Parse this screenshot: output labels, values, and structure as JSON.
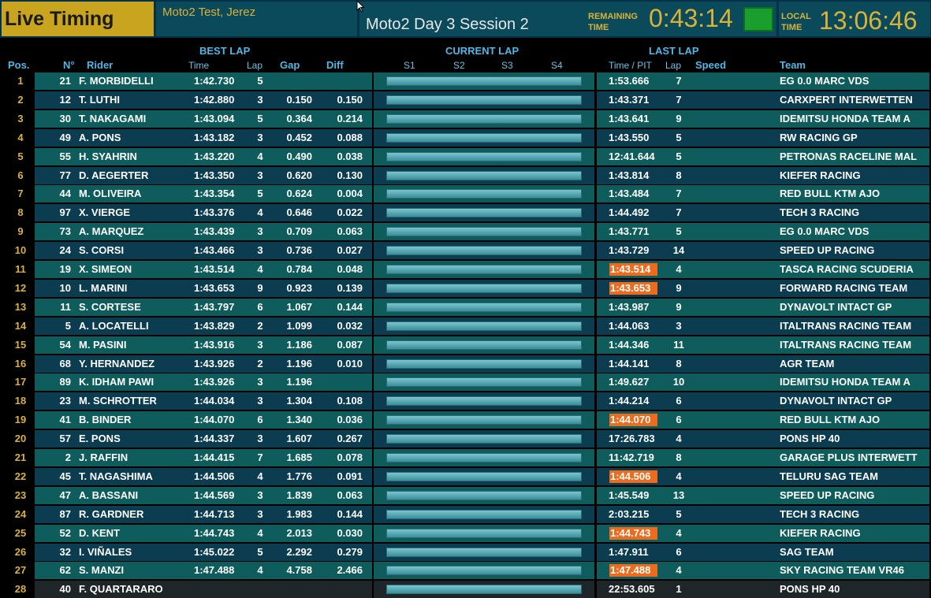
{
  "header": {
    "title": "Live Timing",
    "event": "Moto2 Test, Jerez",
    "session": "Moto2  Day 3 Session 2",
    "remaining_label_1": "REMAINING",
    "remaining_label_2": "TIME",
    "remaining_time": "0:43:14",
    "local_label_1": "LOCAL",
    "local_label_2": "TIME",
    "local_time": "13:06:46",
    "status_color": "#1a9f2e"
  },
  "columns": {
    "best_lap": "BEST LAP",
    "current_lap": "CURRENT LAP",
    "last_lap": "LAST LAP",
    "pos": "Pos.",
    "num": "N°",
    "rider": "Rider",
    "time": "Time",
    "lap": "Lap",
    "gap": "Gap",
    "diff": "Diff",
    "s1": "S1",
    "s2": "S2",
    "s3": "S3",
    "s4": "S4",
    "time_pit": "Time / PIT",
    "last_lap_col": "Lap",
    "speed": "Speed",
    "team": "Team"
  },
  "rows": [
    {
      "pos": "1",
      "num": "21",
      "rider": "F. MORBIDELLI",
      "time": "1:42.730",
      "lap": "5",
      "gap": "",
      "diff": "",
      "last": "1:53.666",
      "last_lap": "7",
      "team": "EG 0.0 MARC VDS",
      "hl": false
    },
    {
      "pos": "2",
      "num": "12",
      "rider": "T. LUTHI",
      "time": "1:42.880",
      "lap": "3",
      "gap": "0.150",
      "diff": "0.150",
      "last": "1:43.371",
      "last_lap": "7",
      "team": "CARXPERT INTERWETTEN",
      "hl": false
    },
    {
      "pos": "3",
      "num": "30",
      "rider": "T. NAKAGAMI",
      "time": "1:43.094",
      "lap": "5",
      "gap": "0.364",
      "diff": "0.214",
      "last": "1:43.641",
      "last_lap": "9",
      "team": "IDEMITSU HONDA TEAM A",
      "hl": false
    },
    {
      "pos": "4",
      "num": "49",
      "rider": "A. PONS",
      "time": "1:43.182",
      "lap": "3",
      "gap": "0.452",
      "diff": "0.088",
      "last": "1:43.550",
      "last_lap": "5",
      "team": "RW RACING GP",
      "hl": false
    },
    {
      "pos": "5",
      "num": "55",
      "rider": "H. SYAHRIN",
      "time": "1:43.220",
      "lap": "4",
      "gap": "0.490",
      "diff": "0.038",
      "last": "12:41.644",
      "last_lap": "5",
      "team": "PETRONAS RACELINE MAL",
      "hl": false
    },
    {
      "pos": "6",
      "num": "77",
      "rider": "D. AEGERTER",
      "time": "1:43.350",
      "lap": "3",
      "gap": "0.620",
      "diff": "0.130",
      "last": "1:43.814",
      "last_lap": "8",
      "team": "KIEFER RACING",
      "hl": false
    },
    {
      "pos": "7",
      "num": "44",
      "rider": "M. OLIVEIRA",
      "time": "1:43.354",
      "lap": "5",
      "gap": "0.624",
      "diff": "0.004",
      "last": "1:43.484",
      "last_lap": "7",
      "team": "RED BULL KTM AJO",
      "hl": false
    },
    {
      "pos": "8",
      "num": "97",
      "rider": "X. VIERGE",
      "time": "1:43.376",
      "lap": "4",
      "gap": "0.646",
      "diff": "0.022",
      "last": "1:44.492",
      "last_lap": "7",
      "team": "TECH 3 RACING",
      "hl": false
    },
    {
      "pos": "9",
      "num": "73",
      "rider": "A. MARQUEZ",
      "time": "1:43.439",
      "lap": "3",
      "gap": "0.709",
      "diff": "0.063",
      "last": "1:43.771",
      "last_lap": "5",
      "team": "EG 0.0 MARC VDS",
      "hl": false
    },
    {
      "pos": "10",
      "num": "24",
      "rider": "S. CORSI",
      "time": "1:43.466",
      "lap": "3",
      "gap": "0.736",
      "diff": "0.027",
      "last": "1:43.729",
      "last_lap": "14",
      "team": "SPEED UP RACING",
      "hl": false
    },
    {
      "pos": "11",
      "num": "19",
      "rider": "X. SIMEON",
      "time": "1:43.514",
      "lap": "4",
      "gap": "0.784",
      "diff": "0.048",
      "last": "1:43.514",
      "last_lap": "4",
      "team": "TASCA RACING SCUDERIA",
      "hl": true
    },
    {
      "pos": "12",
      "num": "10",
      "rider": "L. MARINI",
      "time": "1:43.653",
      "lap": "9",
      "gap": "0.923",
      "diff": "0.139",
      "last": "1:43.653",
      "last_lap": "9",
      "team": "FORWARD RACING TEAM",
      "hl": true
    },
    {
      "pos": "13",
      "num": "11",
      "rider": "S. CORTESE",
      "time": "1:43.797",
      "lap": "6",
      "gap": "1.067",
      "diff": "0.144",
      "last": "1:43.987",
      "last_lap": "9",
      "team": "DYNAVOLT INTACT GP",
      "hl": false
    },
    {
      "pos": "14",
      "num": "5",
      "rider": "A. LOCATELLI",
      "time": "1:43.829",
      "lap": "2",
      "gap": "1.099",
      "diff": "0.032",
      "last": "1:44.063",
      "last_lap": "3",
      "team": "ITALTRANS RACING TEAM",
      "hl": false
    },
    {
      "pos": "15",
      "num": "54",
      "rider": "M. PASINI",
      "time": "1:43.916",
      "lap": "3",
      "gap": "1.186",
      "diff": "0.087",
      "last": "1:44.346",
      "last_lap": "11",
      "team": "ITALTRANS RACING TEAM",
      "hl": false
    },
    {
      "pos": "16",
      "num": "68",
      "rider": "Y. HERNANDEZ",
      "time": "1:43.926",
      "lap": "2",
      "gap": "1.196",
      "diff": "0.010",
      "last": "1:44.141",
      "last_lap": "8",
      "team": "AGR TEAM",
      "hl": false
    },
    {
      "pos": "17",
      "num": "89",
      "rider": "K. IDHAM PAWI",
      "time": "1:43.926",
      "lap": "3",
      "gap": "1.196",
      "diff": "",
      "last": "1:49.627",
      "last_lap": "10",
      "team": "IDEMITSU HONDA TEAM A",
      "hl": false
    },
    {
      "pos": "18",
      "num": "23",
      "rider": "M. SCHROTTER",
      "time": "1:44.034",
      "lap": "3",
      "gap": "1.304",
      "diff": "0.108",
      "last": "1:44.214",
      "last_lap": "6",
      "team": "DYNAVOLT INTACT GP",
      "hl": false
    },
    {
      "pos": "19",
      "num": "41",
      "rider": "B. BINDER",
      "time": "1:44.070",
      "lap": "6",
      "gap": "1.340",
      "diff": "0.036",
      "last": "1:44.070",
      "last_lap": "6",
      "team": "RED BULL KTM AJO",
      "hl": true
    },
    {
      "pos": "20",
      "num": "57",
      "rider": "E. PONS",
      "time": "1:44.337",
      "lap": "3",
      "gap": "1.607",
      "diff": "0.267",
      "last": "17:26.783",
      "last_lap": "4",
      "team": "PONS HP 40",
      "hl": false
    },
    {
      "pos": "21",
      "num": "2",
      "rider": "J. RAFFIN",
      "time": "1:44.415",
      "lap": "7",
      "gap": "1.685",
      "diff": "0.078",
      "last": "11:42.719",
      "last_lap": "8",
      "team": "GARAGE PLUS INTERWETT",
      "hl": false
    },
    {
      "pos": "22",
      "num": "45",
      "rider": "T. NAGASHIMA",
      "time": "1:44.506",
      "lap": "4",
      "gap": "1.776",
      "diff": "0.091",
      "last": "1:44.506",
      "last_lap": "4",
      "team": "TELURU SAG TEAM",
      "hl": true
    },
    {
      "pos": "23",
      "num": "47",
      "rider": "A. BASSANI",
      "time": "1:44.569",
      "lap": "3",
      "gap": "1.839",
      "diff": "0.063",
      "last": "1:45.549",
      "last_lap": "13",
      "team": "SPEED UP RACING",
      "hl": false
    },
    {
      "pos": "24",
      "num": "87",
      "rider": "R. GARDNER",
      "time": "1:44.713",
      "lap": "3",
      "gap": "1.983",
      "diff": "0.144",
      "last": "2:03.215",
      "last_lap": "5",
      "team": "TECH 3 RACING",
      "hl": false
    },
    {
      "pos": "25",
      "num": "52",
      "rider": "D. KENT",
      "time": "1:44.743",
      "lap": "4",
      "gap": "2.013",
      "diff": "0.030",
      "last": "1:44.743",
      "last_lap": "4",
      "team": "KIEFER RACING",
      "hl": true
    },
    {
      "pos": "26",
      "num": "32",
      "rider": "I. VIÑALES",
      "time": "1:45.022",
      "lap": "5",
      "gap": "2.292",
      "diff": "0.279",
      "last": "1:47.911",
      "last_lap": "6",
      "team": "SAG TEAM",
      "hl": false
    },
    {
      "pos": "27",
      "num": "62",
      "rider": "S. MANZI",
      "time": "1:47.488",
      "lap": "4",
      "gap": "4.758",
      "diff": "2.466",
      "last": "1:47.488",
      "last_lap": "4",
      "team": "SKY RACING TEAM VR46",
      "hl": true
    },
    {
      "pos": "28",
      "num": "40",
      "rider": "F. QUARTARARO",
      "time": "",
      "lap": "",
      "gap": "",
      "diff": "",
      "last": "22:53.605",
      "last_lap": "1",
      "team": "PONS HP 40",
      "hl": false
    }
  ]
}
